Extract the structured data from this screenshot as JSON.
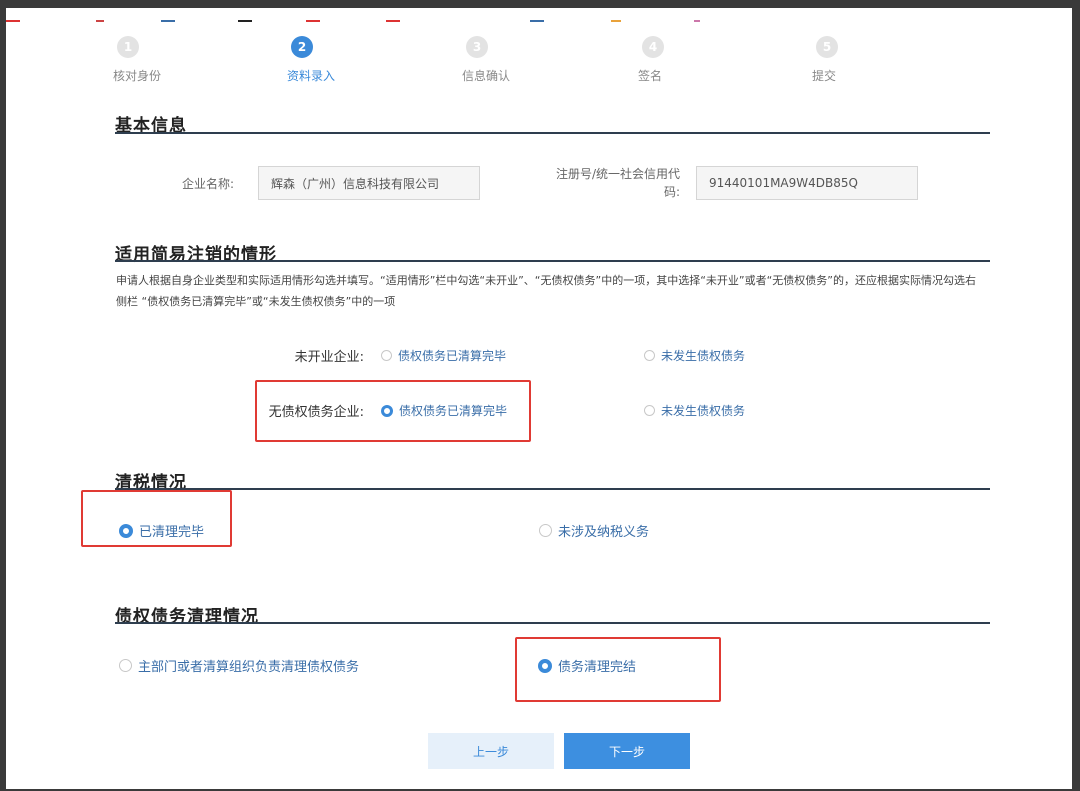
{
  "steps": [
    {
      "num": "1",
      "label": "核对身份"
    },
    {
      "num": "2",
      "label": "资料录入"
    },
    {
      "num": "3",
      "label": "信息确认"
    },
    {
      "num": "4",
      "label": "签名"
    },
    {
      "num": "5",
      "label": "提交"
    }
  ],
  "active_step": 2,
  "basic_info": {
    "title": "基本信息",
    "company_name_label": "企业名称:",
    "company_name_value": "辉森（广州）信息科技有限公司",
    "credit_code_label": "注册号/统一社会信用代码:",
    "credit_code_value": "91440101MA9W4DB85Q"
  },
  "simple_cancel": {
    "title": "适用简易注销的情形",
    "description": "申请人根据自身企业类型和实际适用情形勾选并填写。“适用情形”栏中勾选“未开业”、“无债权债务”中的一项，其中选择“未开业”或者“无债权债务”的，还应根据实际情况勾选右侧栏 “债权债务已清算完毕”或“未发生债权债务”中的一项",
    "rows": [
      {
        "label": "未开业企业:",
        "option_a": "债权债务已清算完毕",
        "option_b": "未发生债权债务",
        "selected": "none"
      },
      {
        "label": "无债权债务企业:",
        "option_a": "债权债务已清算完毕",
        "option_b": "未发生债权债务",
        "selected": "a"
      }
    ]
  },
  "tax": {
    "title": "清税情况",
    "option_a": "已清理完毕",
    "option_b": "未涉及纳税义务",
    "selected": "a"
  },
  "debt": {
    "title": "债权债务清理情况",
    "option_a": "主部门或者清算组织负责清理债权债务",
    "option_b": "债务清理完结",
    "selected": "b"
  },
  "buttons": {
    "prev": "上一步",
    "next": "下一步"
  },
  "colors": {
    "accent": "#3b8ad9",
    "highlight_box": "#e03a34",
    "section_rule": "#2e3e4f"
  }
}
